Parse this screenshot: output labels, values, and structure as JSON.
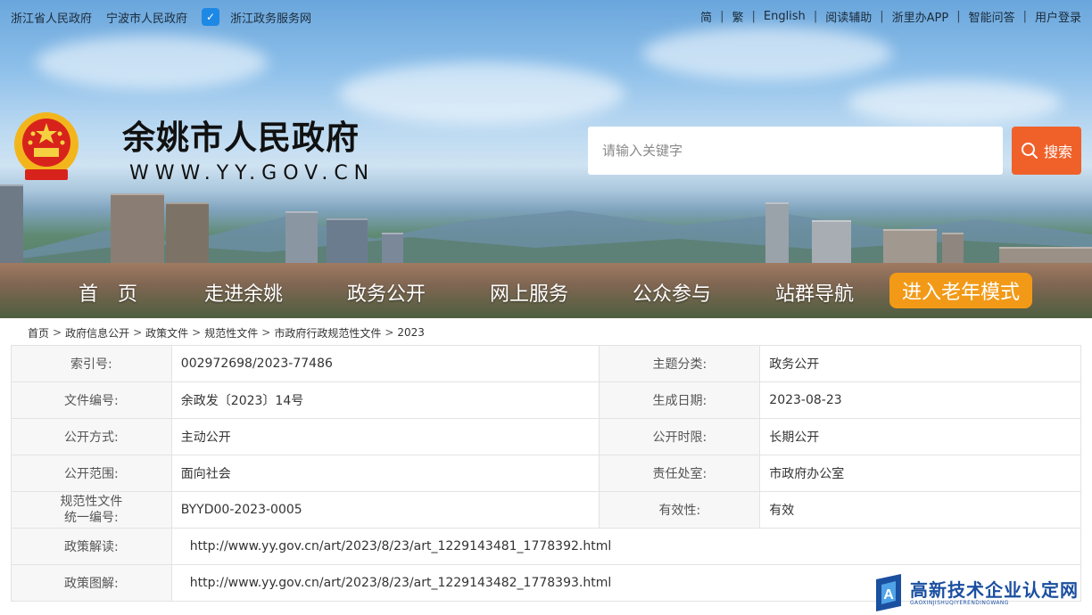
{
  "topbar": {
    "left_links": [
      "浙江省人民政府",
      "宁波市人民政府"
    ],
    "zw_service": "浙江政务服务网",
    "right_links": [
      "简",
      "繁",
      "English",
      "阅读辅助",
      "浙里办APP",
      "智能问答",
      "用户登录"
    ]
  },
  "header": {
    "title": "余姚市人民政府",
    "url": "WWW.YY.GOV.CN",
    "search_placeholder": "请输入关键字",
    "search_button": "搜索"
  },
  "nav": {
    "items": [
      "首　页",
      "走进余姚",
      "政务公开",
      "网上服务",
      "公众参与",
      "站群导航"
    ],
    "elder_mode": "进入老年模式"
  },
  "breadcrumb": [
    "首页",
    "政府信息公开",
    "政策文件",
    "规范性文件",
    "市政府行政规范性文件",
    "2023"
  ],
  "info": {
    "rows": [
      {
        "label": "索引号:",
        "value": "002972698/2023-77486",
        "label2": "主题分类:",
        "value2": "政务公开"
      },
      {
        "label": "文件编号:",
        "value": "余政发〔2023〕14号",
        "label2": "生成日期:",
        "value2": "2023-08-23"
      },
      {
        "label": "公开方式:",
        "value": "主动公开",
        "label2": "公开时限:",
        "value2": "长期公开"
      },
      {
        "label": "公开范围:",
        "value": "面向社会",
        "label2": "责任处室:",
        "value2": "市政府办公室"
      },
      {
        "label_line1": "规范性文件",
        "label_line2": "统一编号:",
        "value": "BYYD00-2023-0005",
        "label2": "有效性:",
        "value2": "有效"
      }
    ],
    "links": [
      {
        "label": "政策解读:",
        "url": "http://www.yy.gov.cn/art/2023/8/23/art_1229143481_1778392.html"
      },
      {
        "label": "政策图解:",
        "url": "http://www.yy.gov.cn/art/2023/8/23/art_1229143482_1778393.html"
      }
    ]
  },
  "watermark": {
    "cn": "高新技术企业认定网",
    "py": "GAOXINJISHUQIYERENDINGWANG"
  },
  "colors": {
    "search_button": "#f0612a",
    "elder_button": "#f29a17",
    "watermark": "#1b4fa0"
  }
}
